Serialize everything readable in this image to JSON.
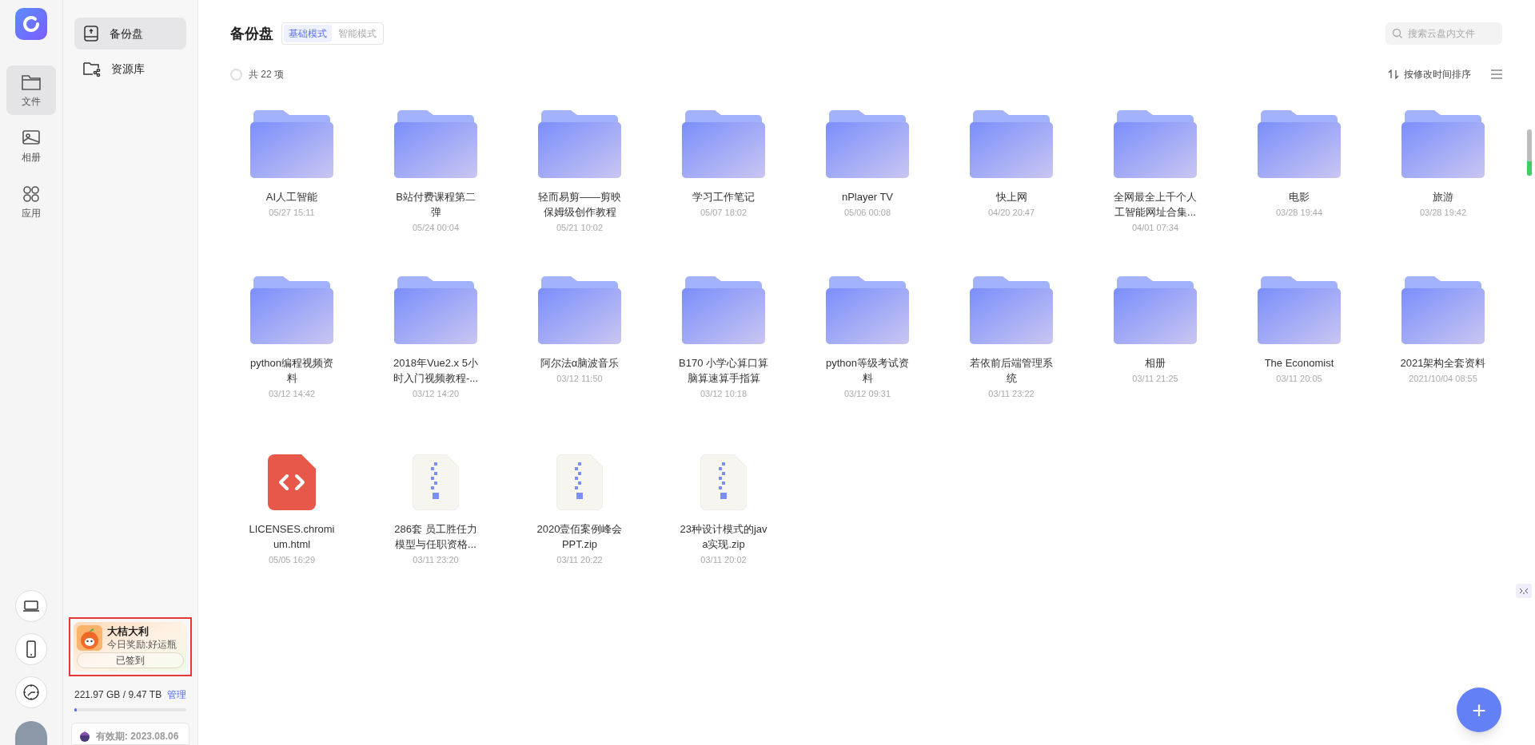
{
  "rail": {
    "items": [
      {
        "kind": "folder",
        "label": "文件",
        "selected": true
      },
      {
        "kind": "photo",
        "label": "相册",
        "selected": false
      },
      {
        "kind": "apps",
        "label": "应用",
        "selected": false
      }
    ]
  },
  "sidebar": {
    "items": [
      {
        "kind": "drive",
        "label": "备份盘",
        "selected": true
      },
      {
        "kind": "share",
        "label": "资源库",
        "selected": false
      }
    ],
    "promo": {
      "title": "大桔大利",
      "subtitle": "今日奖励:好运瓶",
      "button": "已签到",
      "highlighted": true
    },
    "storage": {
      "usage": "221.97 GB / 9.47 TB",
      "manage": "管理",
      "level": 0.02
    },
    "membership": "有效期: 2023.08.06"
  },
  "header": {
    "title": "备份盘",
    "modes": [
      {
        "label": "基础模式",
        "selected": true
      },
      {
        "label": "智能模式",
        "selected": false
      }
    ],
    "search": {
      "placeholder": "搜索云盘内文件"
    },
    "all_selected": false,
    "count": "共 22 项",
    "sort": "按修改时间排序"
  },
  "items": [
    {
      "kind": "folder",
      "name": "AI人工智能",
      "date": "05/27 15:11"
    },
    {
      "kind": "folder",
      "name": "B站付费课程第二弹",
      "date": "05/24 00:04"
    },
    {
      "kind": "folder",
      "name": "轻而易剪——剪映保姆级创作教程",
      "date": "05/21 10:02"
    },
    {
      "kind": "folder",
      "name": "学习工作笔记",
      "date": "05/07 18:02"
    },
    {
      "kind": "folder",
      "name": "nPlayer TV",
      "date": "05/06 00:08"
    },
    {
      "kind": "folder",
      "name": "快上网",
      "date": "04/20 20:47"
    },
    {
      "kind": "folder",
      "name": "全网最全上千个人工智能网址合集...",
      "date": "04/01 07:34"
    },
    {
      "kind": "folder",
      "name": "电影",
      "date": "03/28 19:44"
    },
    {
      "kind": "folder",
      "name": "旅游",
      "date": "03/28 19:42"
    },
    {
      "kind": "folder",
      "name": "python编程视频资料",
      "date": "03/12 14:42"
    },
    {
      "kind": "folder",
      "name": "2018年Vue2.x 5小时入门视频教程-...",
      "date": "03/12 14:20"
    },
    {
      "kind": "folder",
      "name": "阿尔法α脑波音乐",
      "date": "03/12 11:50"
    },
    {
      "kind": "folder",
      "name": "B170 小学心算口算脑算速算手指算",
      "date": "03/12 10:18"
    },
    {
      "kind": "folder",
      "name": "python等级考试资料",
      "date": "03/12 09:31"
    },
    {
      "kind": "folder",
      "name": "若依前后端管理系统",
      "date": "03/11 23:22"
    },
    {
      "kind": "folder",
      "name": "相册",
      "date": "03/11 21:25"
    },
    {
      "kind": "folder",
      "name": "The Economist",
      "date": "03/11 20:05"
    },
    {
      "kind": "folder",
      "name": "2021架构全套资料",
      "date": "2021/10/04 08:55"
    },
    {
      "kind": "html",
      "name": "LICENSES.chromium.html",
      "date": "05/05 16:29"
    },
    {
      "kind": "zip",
      "name": "286套 员工胜任力模型与任职资格...",
      "date": "03/11 23:20"
    },
    {
      "kind": "zip",
      "name": "2020壹佰案例峰会PPT.zip",
      "date": "03/11 20:22"
    },
    {
      "kind": "zip",
      "name": "23种设计模式的java实现.zip",
      "date": "03/11 20:02"
    }
  ],
  "fab": "+"
}
